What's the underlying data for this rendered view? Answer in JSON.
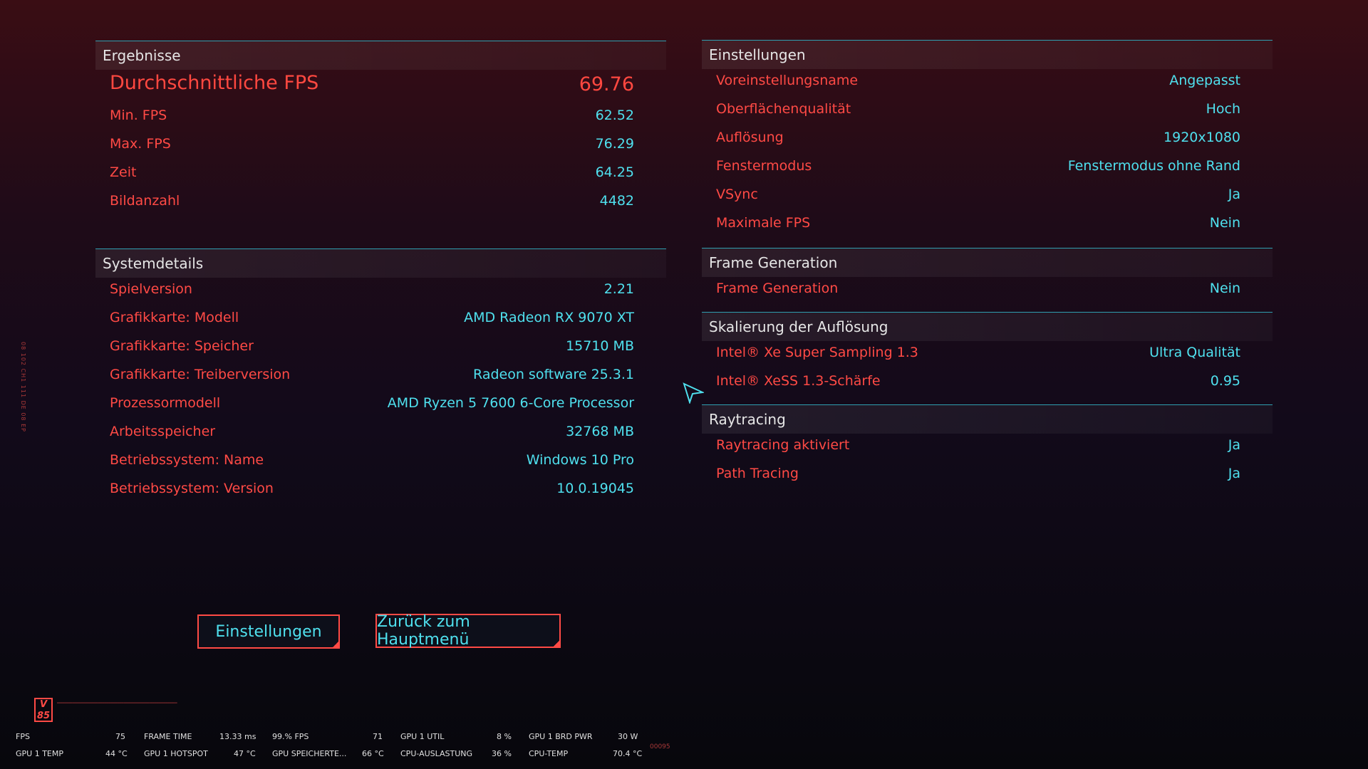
{
  "results": {
    "title": "Ergebnisse",
    "avg_label": "Durchschnittliche FPS",
    "avg_value": "69.76",
    "rows": [
      {
        "label": "Min. FPS",
        "value": "62.52"
      },
      {
        "label": "Max. FPS",
        "value": "76.29"
      },
      {
        "label": "Zeit",
        "value": "64.25"
      },
      {
        "label": "Bildanzahl",
        "value": "4482"
      }
    ]
  },
  "system": {
    "title": "Systemdetails",
    "rows": [
      {
        "label": "Spielversion",
        "value": "2.21"
      },
      {
        "label": "Grafikkarte: Modell",
        "value": "AMD Radeon RX 9070 XT"
      },
      {
        "label": "Grafikkarte: Speicher",
        "value": "15710 MB"
      },
      {
        "label": "Grafikkarte: Treiberversion",
        "value": "Radeon software 25.3.1"
      },
      {
        "label": "Prozessormodell",
        "value": "AMD Ryzen 5 7600 6-Core Processor"
      },
      {
        "label": "Arbeitsspeicher",
        "value": "32768 MB"
      },
      {
        "label": "Betriebssystem: Name",
        "value": "Windows 10 Pro"
      },
      {
        "label": "Betriebssystem: Version",
        "value": "10.0.19045"
      }
    ]
  },
  "settings": {
    "title": "Einstellungen",
    "rows": [
      {
        "label": "Voreinstellungsname",
        "value": "Angepasst"
      },
      {
        "label": "Oberflächenqualität",
        "value": "Hoch"
      },
      {
        "label": "Auflösung",
        "value": "1920x1080"
      },
      {
        "label": "Fenstermodus",
        "value": "Fenstermodus ohne Rand"
      },
      {
        "label": "VSync",
        "value": "Ja"
      },
      {
        "label": "Maximale FPS",
        "value": "Nein"
      }
    ]
  },
  "framegen": {
    "title": "Frame Generation",
    "rows": [
      {
        "label": "Frame Generation",
        "value": "Nein"
      }
    ]
  },
  "scaling": {
    "title": "Skalierung der Auflösung",
    "rows": [
      {
        "label": "Intel® Xe Super Sampling 1.3",
        "value": "Ultra Qualität"
      },
      {
        "label": "Intel® XeSS 1.3-Schärfe",
        "value": "0.95"
      }
    ]
  },
  "raytracing": {
    "title": "Raytracing",
    "rows": [
      {
        "label": "Raytracing aktiviert",
        "value": "Ja"
      },
      {
        "label": "Path Tracing",
        "value": "Ja"
      }
    ]
  },
  "buttons": {
    "settings": "Einstellungen",
    "main_menu": "Zurück zum Hauptmenü"
  },
  "hud": {
    "row1": [
      {
        "label": "FPS",
        "value": "75"
      },
      {
        "label": "FRAME TIME",
        "value": "13.33 ms"
      },
      {
        "label": "99.% FPS",
        "value": "71"
      },
      {
        "label": "GPU 1 UTIL",
        "value": "8 %"
      },
      {
        "label": "GPU 1 BRD PWR",
        "value": "30 W"
      }
    ],
    "row2": [
      {
        "label": "GPU 1 TEMP",
        "value": "44 °C"
      },
      {
        "label": "GPU 1 HOTSPOT",
        "value": "47 °C"
      },
      {
        "label": "GPU SPEICHERTE...",
        "value": "66 °C"
      },
      {
        "label": "CPU-AUSLASTUNG",
        "value": "36 %"
      },
      {
        "label": "CPU-TEMP",
        "value": "70.4 °C"
      }
    ],
    "code": "00095"
  },
  "logo": {
    "text": "V 85"
  },
  "colors": {
    "key": "#ff4a45",
    "value": "#4fe0ee",
    "line": "#2f9fb0"
  }
}
